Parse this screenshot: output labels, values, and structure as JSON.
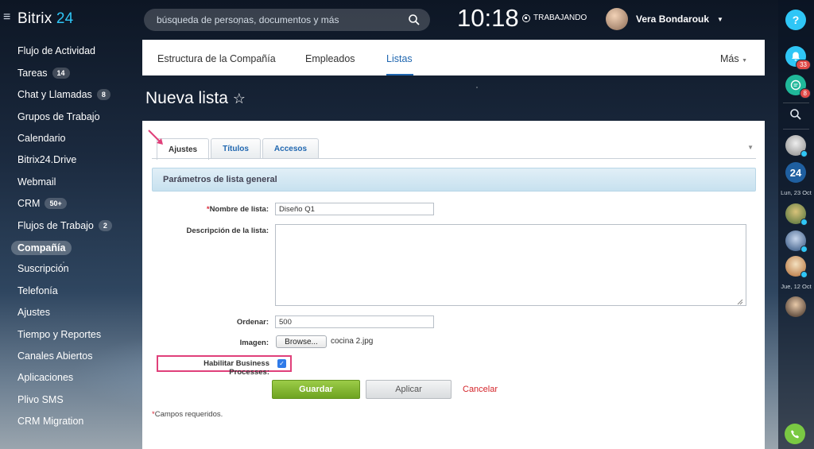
{
  "header": {
    "logo_prefix": "Bitrix",
    "logo_suffix": "24",
    "search_placeholder": "búsqueda de personas, documentos y más",
    "clock": "10:18",
    "status": "TRABAJANDO",
    "user_name": "Vera Bondarouk"
  },
  "sidebar": {
    "items": [
      {
        "label": "Flujo de Actividad",
        "counter": ""
      },
      {
        "label": "Tareas",
        "counter": "14"
      },
      {
        "label": "Chat y Llamadas",
        "counter": "8"
      },
      {
        "label": "Grupos de Trabajo",
        "counter": ""
      },
      {
        "label": "Calendario",
        "counter": ""
      },
      {
        "label": "Bitrix24.Drive",
        "counter": ""
      },
      {
        "label": "Webmail",
        "counter": ""
      },
      {
        "label": "CRM",
        "counter": "50+"
      },
      {
        "label": "Flujos de Trabajo",
        "counter": "2"
      },
      {
        "label": "Compañía",
        "counter": "",
        "active": true
      },
      {
        "label": "Suscripción",
        "counter": ""
      },
      {
        "label": "Telefonía",
        "counter": ""
      },
      {
        "label": "Ajustes",
        "counter": ""
      },
      {
        "label": "Tiempo y Reportes",
        "counter": ""
      },
      {
        "label": "Canales Abiertos",
        "counter": ""
      },
      {
        "label": "Aplicaciones",
        "counter": ""
      },
      {
        "label": "Plivo SMS",
        "counter": ""
      },
      {
        "label": "CRM Migration",
        "counter": ""
      }
    ]
  },
  "rightbar": {
    "help": "?",
    "bell_badge": "33",
    "chat_badge": "8",
    "logo24": "24",
    "date1": "Lun, 23 Oct",
    "date2": "Jue, 12 Oct"
  },
  "topnav": {
    "tabs": [
      "Estructura de la Compañía",
      "Empleados",
      "Listas"
    ],
    "active_tab": "Listas",
    "more": "Más"
  },
  "page": {
    "title": "Nueva lista",
    "star": "☆"
  },
  "form": {
    "tabs": [
      "Ajustes",
      "Títulos",
      "Accesos"
    ],
    "active_tab": "Ajustes",
    "section_title": "Parámetros de lista general",
    "name_label": "Nombre de lista:",
    "name_required_mark": "*",
    "name_value": "Diseño Q1",
    "description_label": "Descripción de la lista:",
    "description_value": "",
    "sort_label": "Ordenar:",
    "sort_value": "500",
    "image_label": "Imagen:",
    "browse_label": "Browse...",
    "image_file": "cocina 2.jpg",
    "bp_label": "Habilitar Business Processes:",
    "bp_checked": true,
    "save_label": "Guardar",
    "apply_label": "Aplicar",
    "cancel_label": "Cancelar",
    "required_note": "Campos requeridos.",
    "required_mark": "*"
  },
  "colors": {
    "accent": "#2fc6f6",
    "link_blue": "#2067b0",
    "save_green": "#7ab52c",
    "cancel_red": "#d4242a",
    "highlight_pink": "#e0407a"
  }
}
